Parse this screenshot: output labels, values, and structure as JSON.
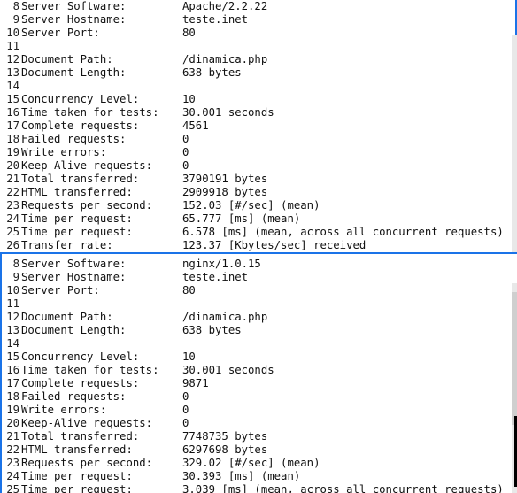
{
  "top": {
    "lines": [
      {
        "n": "8",
        "key": "Server Software:",
        "val": "Apache/2.2.22"
      },
      {
        "n": "9",
        "key": "Server Hostname:",
        "val": "teste.inet"
      },
      {
        "n": "10",
        "key": "Server Port:",
        "val": "80"
      },
      {
        "n": "11",
        "key": "",
        "val": ""
      },
      {
        "n": "12",
        "key": "Document Path:",
        "val": "/dinamica.php"
      },
      {
        "n": "13",
        "key": "Document Length:",
        "val": "638 bytes"
      },
      {
        "n": "14",
        "key": "",
        "val": ""
      },
      {
        "n": "15",
        "key": "Concurrency Level:",
        "val": "10"
      },
      {
        "n": "16",
        "key": "Time taken for tests:",
        "val": "30.001 seconds"
      },
      {
        "n": "17",
        "key": "Complete requests:",
        "val": "4561"
      },
      {
        "n": "18",
        "key": "Failed requests:",
        "val": "0"
      },
      {
        "n": "19",
        "key": "Write errors:",
        "val": "0"
      },
      {
        "n": "20",
        "key": "Keep-Alive requests:",
        "val": "0"
      },
      {
        "n": "21",
        "key": "Total transferred:",
        "val": "3790191 bytes"
      },
      {
        "n": "22",
        "key": "HTML transferred:",
        "val": "2909918 bytes"
      },
      {
        "n": "23",
        "key": "Requests per second:",
        "val": "152.03 [#/sec] (mean)"
      },
      {
        "n": "24",
        "key": "Time per request:",
        "val": "65.777 [ms] (mean)"
      },
      {
        "n": "25",
        "key": "Time per request:",
        "val": "6.578 [ms] (mean, across all concurrent requests)"
      },
      {
        "n": "26",
        "key": "Transfer rate:",
        "val": "123.37 [Kbytes/sec] received"
      }
    ]
  },
  "bottom": {
    "lines": [
      {
        "n": "8",
        "key": "Server Software:",
        "val": "nginx/1.0.15"
      },
      {
        "n": "9",
        "key": "Server Hostname:",
        "val": "teste.inet"
      },
      {
        "n": "10",
        "key": "Server Port:",
        "val": "80"
      },
      {
        "n": "11",
        "key": "",
        "val": ""
      },
      {
        "n": "12",
        "key": "Document Path:",
        "val": "/dinamica.php"
      },
      {
        "n": "13",
        "key": "Document Length:",
        "val": "638 bytes"
      },
      {
        "n": "14",
        "key": "",
        "val": ""
      },
      {
        "n": "15",
        "key": "Concurrency Level:",
        "val": "10"
      },
      {
        "n": "16",
        "key": "Time taken for tests:",
        "val": "30.001 seconds"
      },
      {
        "n": "17",
        "key": "Complete requests:",
        "val": "9871"
      },
      {
        "n": "18",
        "key": "Failed requests:",
        "val": "0"
      },
      {
        "n": "19",
        "key": "Write errors:",
        "val": "0"
      },
      {
        "n": "20",
        "key": "Keep-Alive requests:",
        "val": "0"
      },
      {
        "n": "21",
        "key": "Total transferred:",
        "val": "7748735 bytes"
      },
      {
        "n": "22",
        "key": "HTML transferred:",
        "val": "6297698 bytes"
      },
      {
        "n": "23",
        "key": "Requests per second:",
        "val": "329.02 [#/sec] (mean)"
      },
      {
        "n": "24",
        "key": "Time per request:",
        "val": "30.393 [ms] (mean)"
      },
      {
        "n": "25",
        "key": "Time per request:",
        "val": "3.039 [ms] (mean, across all concurrent requests)"
      }
    ]
  },
  "colors": {
    "accent_border": "#1a73e8",
    "text": "#111111",
    "background": "#ffffff"
  }
}
